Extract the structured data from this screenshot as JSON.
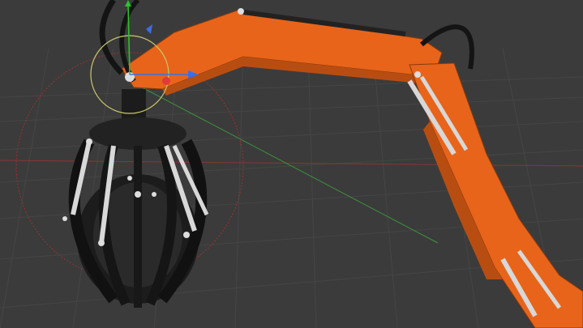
{
  "viewport": {
    "label": "3d-viewport",
    "colors": {
      "background": "#3b3b3b",
      "grid": "#4a4a4a",
      "axis_x": "#b23a3a",
      "axis_y": "#3f9a3f",
      "arm_orange": "#e8641a",
      "arm_orange_dark": "#b84d12",
      "steel": "#d8d8d8",
      "grab_black": "#1c1c1c",
      "hose_black": "#141414",
      "gizmo_x": "#e03a3a",
      "gizmo_y": "#2fc02f",
      "gizmo_z": "#3a6ee8",
      "rotate_circle": "#c8c86a",
      "bounds_circle": "#b43030"
    },
    "objects": [
      {
        "name": "excavator-boom",
        "icon": "arm"
      },
      {
        "name": "grapple-claw",
        "icon": "claw"
      },
      {
        "name": "transform-gizmo",
        "icon": "gizmo"
      }
    ]
  }
}
